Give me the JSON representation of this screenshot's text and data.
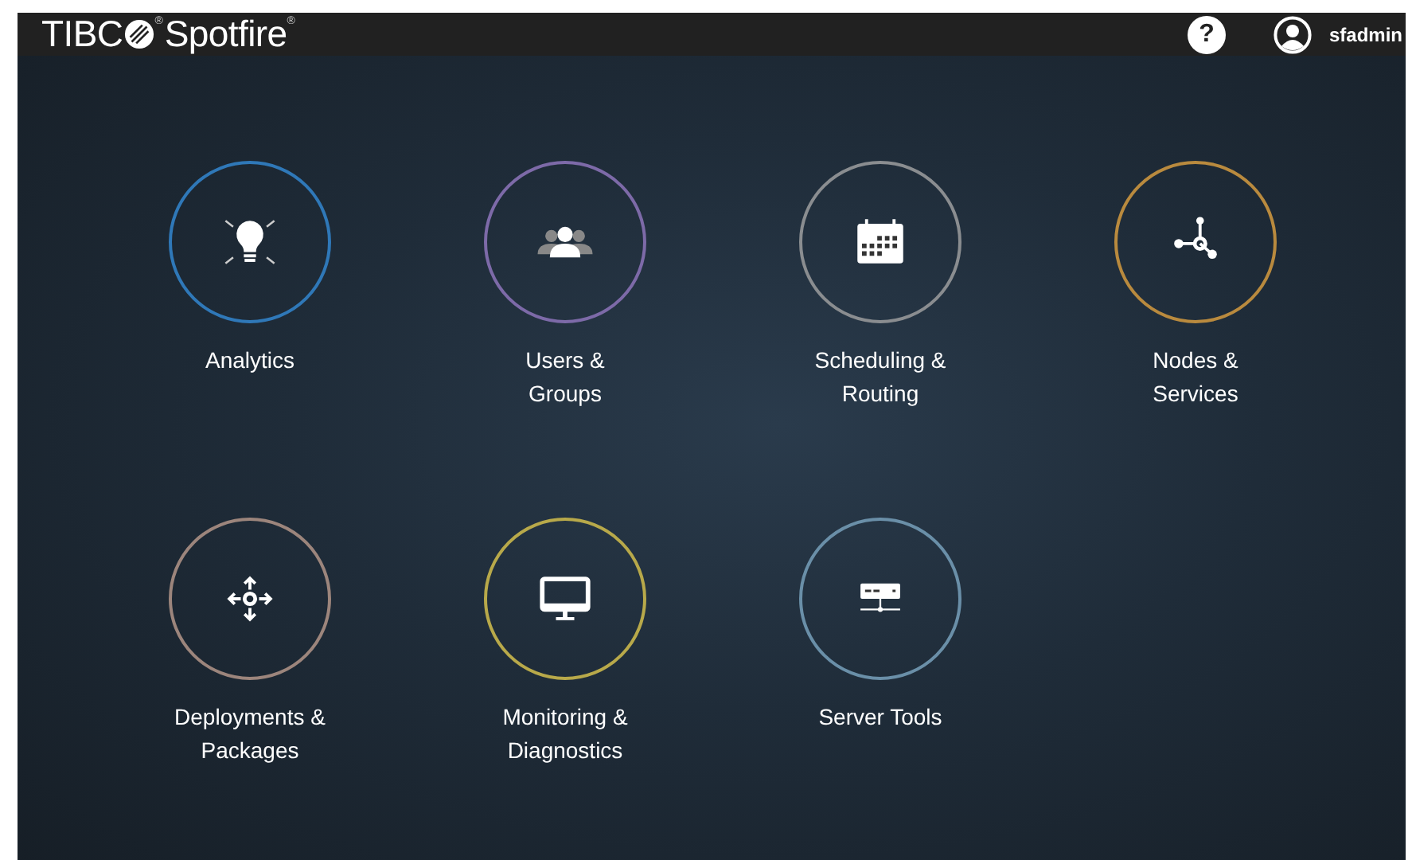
{
  "header": {
    "logo": {
      "brand": "TIBC",
      "product": "Spotfire",
      "reg_marks": [
        "®",
        "®"
      ]
    },
    "help": {
      "label": "?"
    },
    "user": {
      "name": "sfadmin"
    }
  },
  "tiles": [
    {
      "kind": "analytics",
      "lines": [
        "Analytics"
      ],
      "color": "#2f78b8"
    },
    {
      "kind": "users",
      "lines": [
        "Users &",
        "Groups"
      ],
      "color": "#7d6aa8"
    },
    {
      "kind": "scheduling",
      "lines": [
        "Scheduling &",
        "Routing"
      ],
      "color": "#8a8d90"
    },
    {
      "kind": "nodes",
      "lines": [
        "Nodes &",
        "Services"
      ],
      "color": "#b98a3e"
    },
    {
      "kind": "deployments",
      "lines": [
        "Deployments &",
        "Packages"
      ],
      "color": "#9c857c"
    },
    {
      "kind": "monitoring",
      "lines": [
        "Monitoring &",
        "Diagnostics"
      ],
      "color": "#b8a94a"
    },
    {
      "kind": "server",
      "lines": [
        "Server Tools"
      ],
      "color": "#6a8fa8"
    }
  ]
}
